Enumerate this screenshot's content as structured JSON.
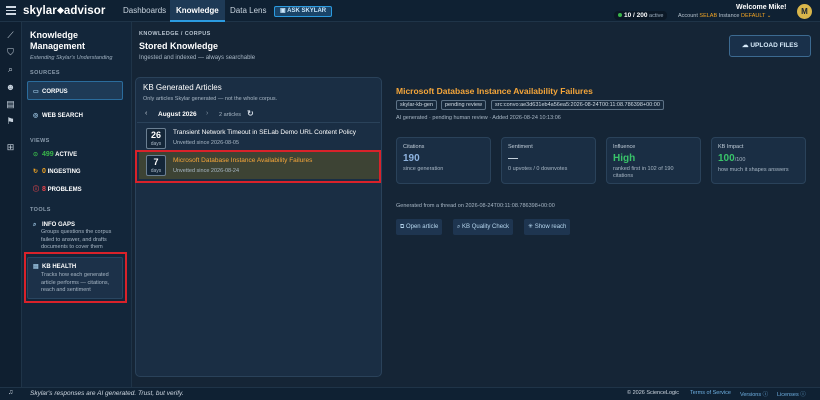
{
  "app": {
    "name": "skylar advisor",
    "logo_left": "skylar",
    "logo_right": "advisor",
    "nav": [
      "Dashboards",
      "Knowledge",
      "Data Lens"
    ],
    "ask_label": "ASK SKYLAR",
    "usage": {
      "value": "10 / 200",
      "suffix": "active"
    },
    "welcome": "Welcome Mike!",
    "account_label": "Account",
    "account_value": "SELAB",
    "instance_label": "Instance",
    "instance_value": "DEFAULT",
    "avatar_initial": "M"
  },
  "sidebar": {
    "title": "Knowledge Management",
    "subtitle": "Extending Skylar's Understanding",
    "sources_heading": "SOURCES",
    "sources": [
      {
        "label": "CORPUS",
        "icon": "book-icon"
      },
      {
        "label": "WEB SEARCH",
        "icon": "globe-icon"
      }
    ],
    "views_heading": "VIEWS",
    "views": [
      {
        "count": "499",
        "label": "ACTIVE",
        "color": "#39b54a",
        "icon": "check-circle-icon"
      },
      {
        "count": "0",
        "label": "INGESTING",
        "color": "#f5a623",
        "icon": "sync-icon"
      },
      {
        "count": "8",
        "label": "PROBLEMS",
        "color": "#e8454c",
        "icon": "alert-icon"
      }
    ],
    "tools_heading": "TOOLS",
    "tools": [
      {
        "label": "INFO GAPS",
        "desc": "Groups questions the corpus failed to answer, and drafts documents to cover them",
        "icon": "search-gap-icon"
      },
      {
        "label": "KB HEALTH",
        "desc": "Tracks how each generated article performs — citations, reach and sentiment",
        "icon": "chart-icon"
      }
    ]
  },
  "header": {
    "breadcrumb": "KNOWLEDGE / CORPUS",
    "title": "Stored Knowledge",
    "subtitle": "Ingested and indexed — always searchable",
    "upload_label": "UPLOAD FILES"
  },
  "articles": {
    "title": "KB Generated Articles",
    "subtitle": "Only articles Skylar generated — not the whole corpus.",
    "month": "August 2026",
    "count": "2 articles",
    "items": [
      {
        "day": "26",
        "unit": "days",
        "title": "Transient Network Timeout in SELab Demo URL Content Policy",
        "meta": "Unvetted since 2026-08-05"
      },
      {
        "day": "7",
        "unit": "days",
        "title": "Microsoft Database Instance Availability Failures",
        "meta": "Unvetted since 2026-08-24"
      }
    ]
  },
  "detail": {
    "title": "Microsoft Database Instance Availability Failures",
    "tags": [
      "skylar-kb-gen",
      "pending review",
      "src:convo:ae3d631eb4a56ea5:2026-08-24T00:11:08.786398+00:00"
    ],
    "meta": "AI generated · pending human review · Added 2026-08-24 10:13:06",
    "cards": [
      {
        "label": "Citations",
        "value": "190",
        "sub": "since generation",
        "color": "#8fb4e0"
      },
      {
        "label": "Sentiment",
        "value": "—",
        "sub": "0 upvotes / 0 downvotes",
        "color": "#c3cfda"
      },
      {
        "label": "Influence",
        "value": "High",
        "sub": "ranked first in 102 of 190 citations",
        "color": "#39c46a"
      },
      {
        "label": "KB Impact",
        "value": "100",
        "value_suffix": "/100",
        "sub": "how much it shapes answers",
        "color": "#39c46a"
      }
    ],
    "generated": "Generated from a thread on 2026-08-24T00:11:08.786398+00:00",
    "actions": [
      {
        "label": "Open article",
        "icon": "external-link-icon"
      },
      {
        "label": "KB Quality Check",
        "icon": "magnifier-icon"
      },
      {
        "label": "Show reach",
        "icon": "reach-icon"
      }
    ]
  },
  "footer": {
    "disclaimer": "Skylar's responses are AI generated. Trust, but verify.",
    "copyright": "© 2026 ScienceLogic",
    "terms": "Terms of Service",
    "versions": "Versions",
    "licenses": "Licenses"
  }
}
